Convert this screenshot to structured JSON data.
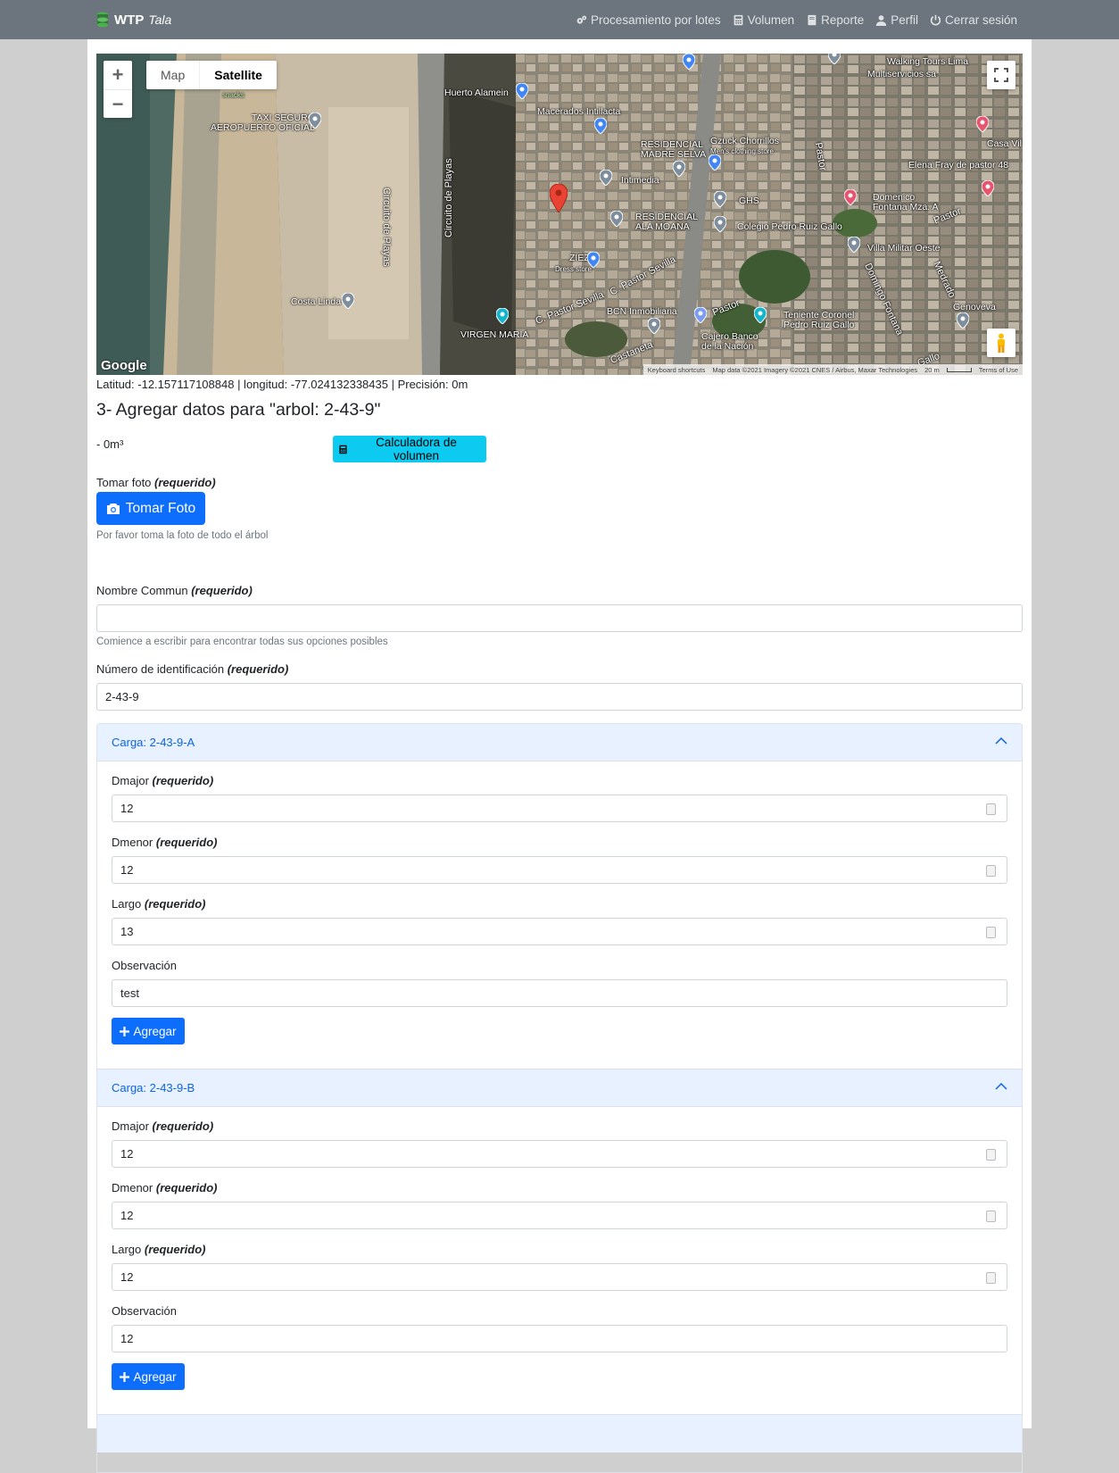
{
  "navbar": {
    "brand_primary": "WTP",
    "brand_secondary": "Tala",
    "links": [
      {
        "label": "Procesamiento por lotes",
        "icon": "gears-icon"
      },
      {
        "label": "Volumen",
        "icon": "calculator-icon"
      },
      {
        "label": "Reporte",
        "icon": "book-icon"
      },
      {
        "label": "Perfil",
        "icon": "user-icon"
      },
      {
        "label": "Cerrar sesión",
        "icon": "power-icon"
      }
    ]
  },
  "map": {
    "type_map": "Map",
    "type_satellite": "Satellite",
    "active_type": "Satellite",
    "labels": {
      "walking_tours": "Walking Tours Lima",
      "multiservicios": "Multiservicios sa",
      "huerto": "Huerto Alamein",
      "macerados": "Macerados Intillacta",
      "taxi": "TAXI SEGURO\nAEROPUERTO OFICIAL",
      "snacks": "snacks",
      "residencial_madre": "RESIDENCIAL\nMADRE SELVA",
      "gzuck": "Gzuck Chorrillos",
      "gzuck_sub": "Men's clothing store",
      "casa": "Casa Vil",
      "elena": "Elena Fray de pastor 48",
      "intimedia": "Intimedia",
      "ghs": "GHS",
      "domenico": "Domenico\nFontana Mza. A",
      "residencial_ala": "RESIDENCIAL\nALA MOANA",
      "colegio": "Colegio Pedro Ruiz Gallo",
      "villa": "Villa Militar Oeste",
      "ziez": "ZIEZ",
      "ziez_sub": "Dress store",
      "costa": "Costa Linda",
      "bcn": "BCN Inmobiliaria",
      "teniente": "Teniente Coronel\nPedro Ruiz Gallo",
      "genoveva": "Genoveva",
      "virgen": "VIRGEN MARIA",
      "cajero": "Cajero Banco\nde la Nación",
      "circuito1": "Circuito de Playas",
      "circuito2": "Circuito de Playas",
      "pastor_sevilla1": "C. Pastor Sevilla",
      "pastor_sevilla2": "C. Pastor Sevilla",
      "pastor1": "Pastor",
      "pastor2": "Pastor",
      "pastor3": "Pastor",
      "domingo": "Domingo Fontana",
      "medrado": "Medrado",
      "gallo": "Gallo",
      "castaneta": "Castaneta"
    },
    "attribution": {
      "shortcuts": "Keyboard shortcuts",
      "data": "Map data ©2021 Imagery ©2021 CNES / Airbus, Maxar Technologies",
      "scale": "20 m",
      "terms": "Terms of Use"
    },
    "google": "Google"
  },
  "location_text": "Latitud: -12.157117108848 | longitud: -77.024132338435 | Precisión: 0m",
  "page_title": "3- Agregar datos para \"arbol: 2-43-9\"",
  "volume_text": "- 0m³",
  "calc_button": "Calculadora de volumen",
  "photo": {
    "label": "Tomar foto",
    "required": "(requerido)",
    "button": "Tomar Foto",
    "help": "Por favor toma la foto de todo el árbol"
  },
  "common_name": {
    "label": "Nombre Commun",
    "required": "(requerido)",
    "value": "",
    "help": "Comience a escribir para encontrar todas sus opciones posibles"
  },
  "id_number": {
    "label": "Número de identificación",
    "required": "(requerido)",
    "value": "2-43-9"
  },
  "cargas": [
    {
      "title": "Carga: 2-43-9-A",
      "dmajor_label": "Dmajor",
      "dmajor": "12",
      "dmenor_label": "Dmenor",
      "dmenor": "12",
      "largo_label": "Largo",
      "largo": "13",
      "obs_label": "Observación",
      "obs": "test",
      "required": "(requerido)",
      "add_label": "Agregar"
    },
    {
      "title": "Carga: 2-43-9-B",
      "dmajor_label": "Dmajor",
      "dmajor": "12",
      "dmenor_label": "Dmenor",
      "dmenor": "12",
      "largo_label": "Largo",
      "largo": "12",
      "obs_label": "Observación",
      "obs": "12",
      "required": "(requerido)",
      "add_label": "Agregar"
    }
  ],
  "colors": {
    "navbar": "#6c757d",
    "primary": "#0d6efd",
    "info": "#0dcaf0",
    "accordion_header": "#e7f1ff",
    "accordion_text": "#0c63e4"
  }
}
